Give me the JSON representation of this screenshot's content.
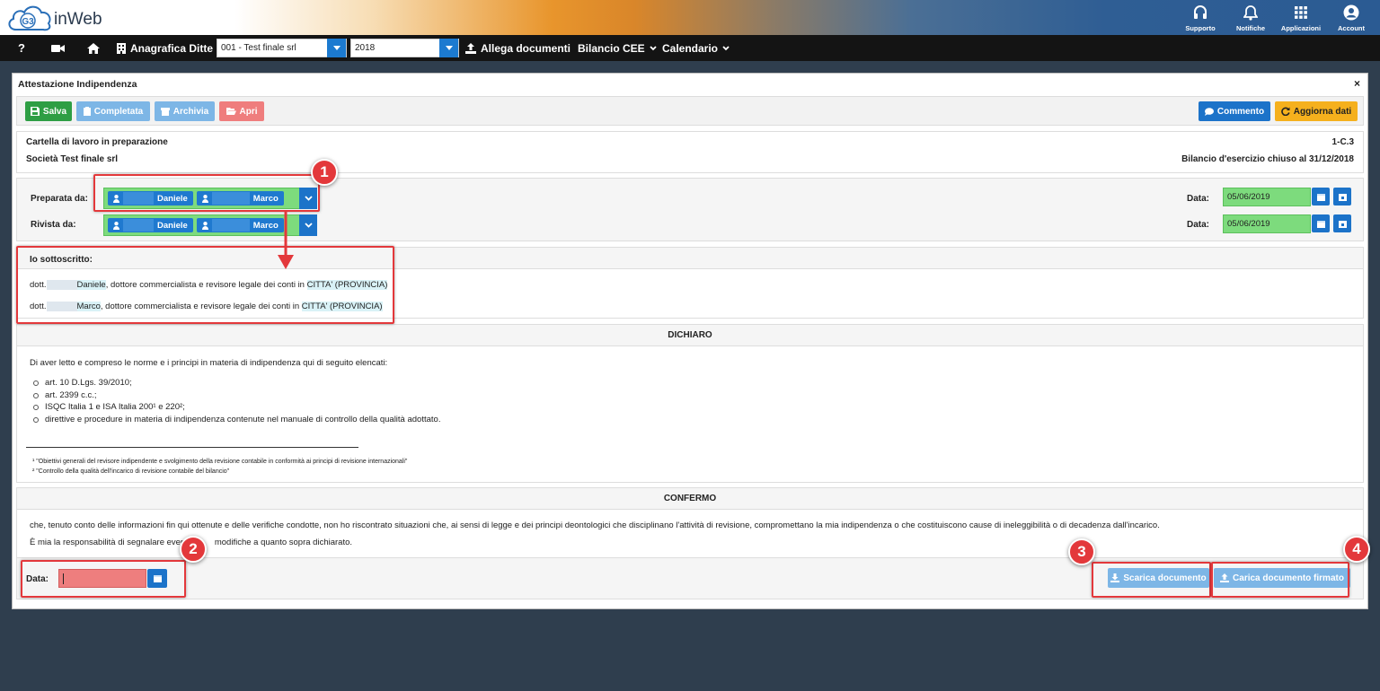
{
  "app": {
    "logo_mark": "G3",
    "logo_text": "inWeb"
  },
  "top_icons": [
    {
      "label": "Supporto",
      "icon": "headset-icon"
    },
    {
      "label": "Notifiche",
      "icon": "bell-icon"
    },
    {
      "label": "Applicazioni",
      "icon": "grid-icon"
    },
    {
      "label": "Account",
      "icon": "user-circle-icon"
    }
  ],
  "navbar": {
    "help": "?",
    "anagrafica_label": "Anagrafica Ditte",
    "company_select": "001 - Test finale srl",
    "year_select": "2018",
    "allega_label": "Allega documenti",
    "bilancio_label": "Bilancio CEE",
    "calendario_label": "Calendario"
  },
  "panel": {
    "title": "Attestazione Indipendenza",
    "close": "×"
  },
  "toolbar": {
    "salva": "Salva",
    "completata": "Completata",
    "archivia": "Archivia",
    "apri": "Apri",
    "commento": "Commento",
    "aggiorna": "Aggiorna dati"
  },
  "info": {
    "status": "Cartella di lavoro in preparazione",
    "code": "1-C.3",
    "company": "Società Test finale srl",
    "bilancio": "Bilancio d'esercizio chiuso al 31/12/2018"
  },
  "signers": {
    "preparata_label": "Preparata da:",
    "rivista_label": "Rivista da:",
    "user1": "Daniele",
    "user2": "Marco",
    "data_label": "Data:",
    "preparata_date": "05/06/2019",
    "rivista_date": "05/06/2019"
  },
  "sottoscritto": {
    "heading": "Io sottoscritto:",
    "lines": [
      {
        "prefix": "dott.",
        "name": "Daniele",
        "middle": ", dottore commercialista e revisore legale dei conti in ",
        "city": "CITTA' (PROVINCIA)"
      },
      {
        "prefix": "dott.",
        "name": "Marco",
        "middle": ", dottore commercialista e revisore legale dei conti in ",
        "city": "CITTA' (PROVINCIA)"
      }
    ]
  },
  "dichiaro": {
    "heading": "DICHIARO",
    "intro": "Di aver letto e compreso le norme e i principi in materia di indipendenza qui di seguito elencati:",
    "items": [
      "art. 10 D.Lgs. 39/2010;",
      "art. 2399 c.c.;",
      "ISQC Italia 1 e ISA Italia 200¹ e 220²;",
      "direttive e procedure in materia di indipendenza contenute nel manuale di controllo della qualità adottato."
    ],
    "footnote1": "¹ \"Obiettivi generali del revisore indipendente e svolgimento della revisione contabile in conformità ai principi di revisione internazionali\"",
    "footnote2": "² \"Controllo della qualità dell'incarico di revisione contabile del bilancio\""
  },
  "confermo": {
    "heading": "CONFERMO",
    "line1": "che, tenuto conto delle informazioni fin qui ottenute e delle verifiche condotte, non ho riscontrato situazioni che, ai sensi di legge e dei principi deontologici che disciplinano l'attività di revisione, compromettano la mia indipendenza o che costituiscono cause di ineleggibilità o di decadenza dall'incarico.",
    "line2_a": "È mia la responsabilità di segnalare event",
    "line2_b": "modifiche a quanto sopra dichiarato."
  },
  "footer": {
    "data_label": "Data:",
    "date_value": "",
    "scarica": "Scarica documento",
    "carica": "Carica documento firmato"
  },
  "callouts": [
    "1",
    "2",
    "3",
    "4"
  ],
  "colors": {
    "salva": "#2e9e44",
    "completata": "#7db6e6",
    "archivia": "#7db6e6",
    "apri": "#ef7d7d",
    "commento": "#1c73c9",
    "aggiorna": "#f5b01d",
    "callout_red": "#e3383b",
    "field_green": "#7ddb7d",
    "field_error": "#ee7e7e"
  }
}
